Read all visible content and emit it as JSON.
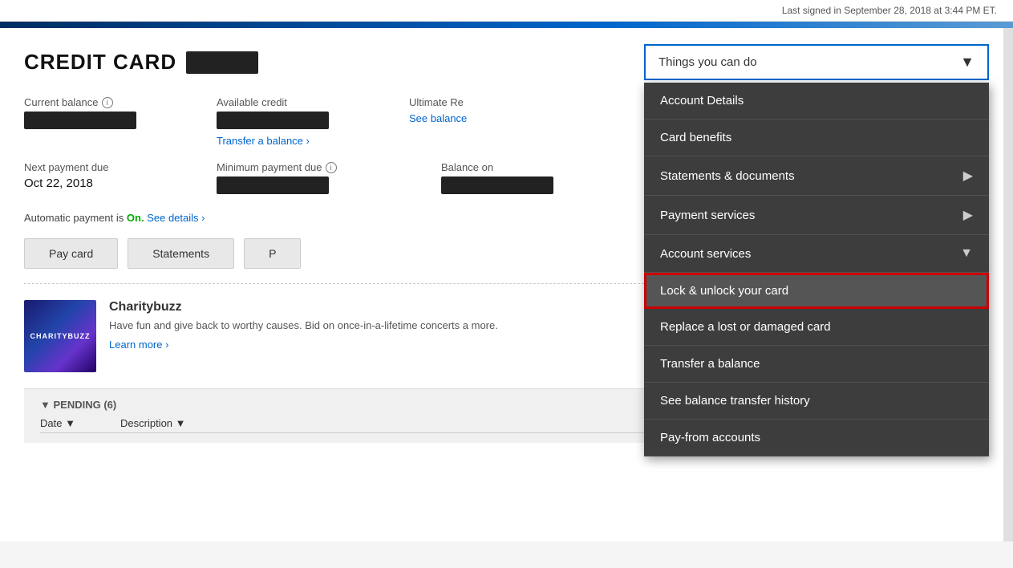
{
  "topbar": {
    "last_signed": "Last signed in September 28, 2018 at 3:44 PM ET."
  },
  "header": {
    "title": "CREDIT CARD",
    "card_mask": ""
  },
  "dropdown": {
    "button_label": "Things you can do",
    "items": [
      {
        "id": "account-details",
        "label": "Account Details",
        "has_arrow": false,
        "highlighted": false
      },
      {
        "id": "card-benefits",
        "label": "Card benefits",
        "has_arrow": false,
        "highlighted": false
      },
      {
        "id": "statements-documents",
        "label": "Statements & documents",
        "has_arrow": true,
        "highlighted": false
      },
      {
        "id": "payment-services",
        "label": "Payment services",
        "has_arrow": true,
        "highlighted": false
      },
      {
        "id": "account-services",
        "label": "Account services",
        "has_arrow": true,
        "highlighted": false
      },
      {
        "id": "lock-unlock",
        "label": "Lock & unlock your card",
        "has_arrow": false,
        "highlighted": true
      },
      {
        "id": "replace-card",
        "label": "Replace a lost or damaged card",
        "has_arrow": false,
        "highlighted": false
      },
      {
        "id": "transfer-balance",
        "label": "Transfer a balance",
        "has_arrow": false,
        "highlighted": false
      },
      {
        "id": "see-balance-history",
        "label": "See balance transfer history",
        "has_arrow": false,
        "highlighted": false
      },
      {
        "id": "pay-from-accounts",
        "label": "Pay-from accounts",
        "has_arrow": false,
        "highlighted": false
      }
    ]
  },
  "balance": {
    "current_balance_label": "Current balance",
    "available_credit_label": "Available credit",
    "ultimate_rewards_label": "Ultimate Re",
    "transfer_link": "Transfer a balance ›",
    "see_balance_link": "See balance"
  },
  "payment": {
    "next_payment_label": "Next payment due",
    "next_payment_date": "Oct 22, 2018",
    "min_payment_label": "Minimum payment due",
    "balance_on_label": "Balance on",
    "auto_payment_text": "Automatic payment is",
    "auto_on": "On.",
    "see_details": "See details ›"
  },
  "buttons": {
    "pay_card": "Pay card",
    "statements": "Statements",
    "third_btn": "P"
  },
  "charity": {
    "name": "Charitybuzz",
    "img_label": "CHARITYBUZZ",
    "description": "Have fun and give back to worthy causes. Bid on once-in-a-lifetime concerts a more.",
    "learn_more": "Learn more ›"
  },
  "pending": {
    "label": "▼ PENDING (6)"
  },
  "table": {
    "col_date": "Date ▼",
    "col_description": "Description ▼"
  }
}
